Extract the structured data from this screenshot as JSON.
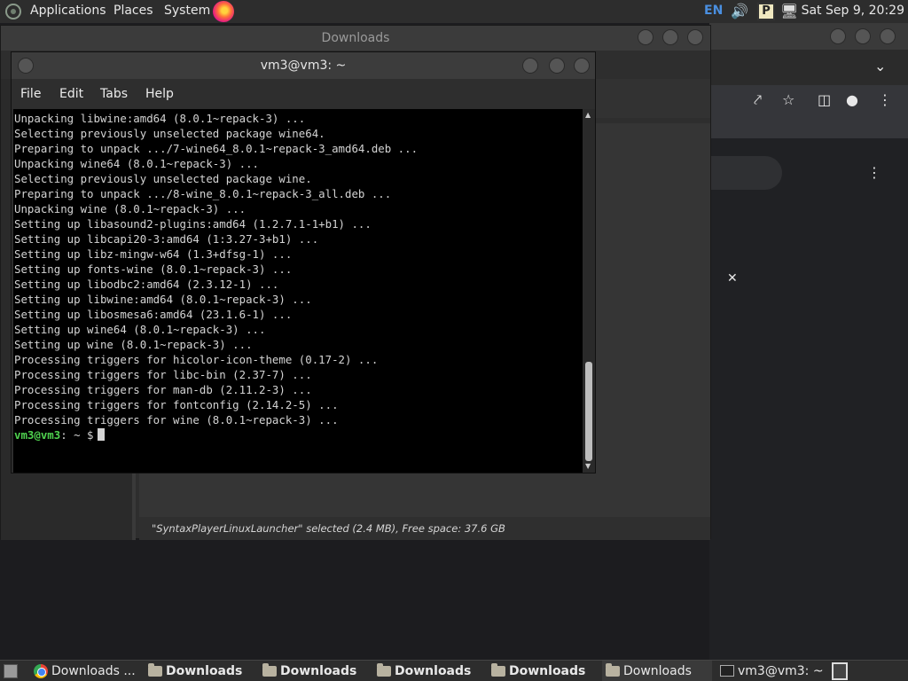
{
  "top_panel": {
    "menus": [
      "Applications",
      "Places",
      "System"
    ],
    "keyboard_layout": "EN",
    "clock": "Sat Sep 9, 20:29",
    "tray_p_label": "P"
  },
  "file_manager": {
    "title": "Downloads",
    "status": "\"SyntaxPlayerLinuxLauncher\" selected (2.4 MB), Free space: 37.6 GB"
  },
  "terminal": {
    "title": "vm3@vm3: ~",
    "menu": [
      "File",
      "Edit",
      "Tabs",
      "Help"
    ],
    "lines": [
      "Unpacking libwine:amd64 (8.0.1~repack-3) ...",
      "Selecting previously unselected package wine64.",
      "Preparing to unpack .../7-wine64_8.0.1~repack-3_amd64.deb ...",
      "Unpacking wine64 (8.0.1~repack-3) ...",
      "Selecting previously unselected package wine.",
      "Preparing to unpack .../8-wine_8.0.1~repack-3_all.deb ...",
      "Unpacking wine (8.0.1~repack-3) ...",
      "Setting up libasound2-plugins:amd64 (1.2.7.1-1+b1) ...",
      "Setting up libcapi20-3:amd64 (1:3.27-3+b1) ...",
      "Setting up libz-mingw-w64 (1.3+dfsg-1) ...",
      "Setting up fonts-wine (8.0.1~repack-3) ...",
      "Setting up libodbc2:amd64 (2.3.12-1) ...",
      "Setting up libwine:amd64 (8.0.1~repack-3) ...",
      "Setting up libosmesa6:amd64 (23.1.6-1) ...",
      "Setting up wine64 (8.0.1~repack-3) ...",
      "Setting up wine (8.0.1~repack-3) ...",
      "Processing triggers for hicolor-icon-theme (0.17-2) ...",
      "Processing triggers for libc-bin (2.37-7) ...",
      "Processing triggers for man-db (2.11.2-3) ...",
      "Processing triggers for fontconfig (2.14.2-5) ...",
      "Processing triggers for wine (8.0.1~repack-3) ..."
    ],
    "prompt_user": "vm3@vm3",
    "prompt_rest": ": ~ $"
  },
  "taskbar": {
    "tasks": [
      {
        "label": "Downloads ...",
        "icon": "chrome-icon"
      },
      {
        "label": "Downloads",
        "icon": "folder-icon"
      },
      {
        "label": "Downloads",
        "icon": "folder-icon"
      },
      {
        "label": "Downloads",
        "icon": "folder-icon"
      },
      {
        "label": "Downloads",
        "icon": "folder-icon"
      },
      {
        "label": "Downloads",
        "icon": "folder-icon"
      },
      {
        "label": "vm3@vm3: ~",
        "icon": "terminal-icon"
      }
    ]
  },
  "colors": {
    "prompt": "#4fd24f",
    "terminal_bg": "#000000",
    "panel_bg": "#2d2d2d",
    "keyboard_layout": "#4a8fe0"
  }
}
